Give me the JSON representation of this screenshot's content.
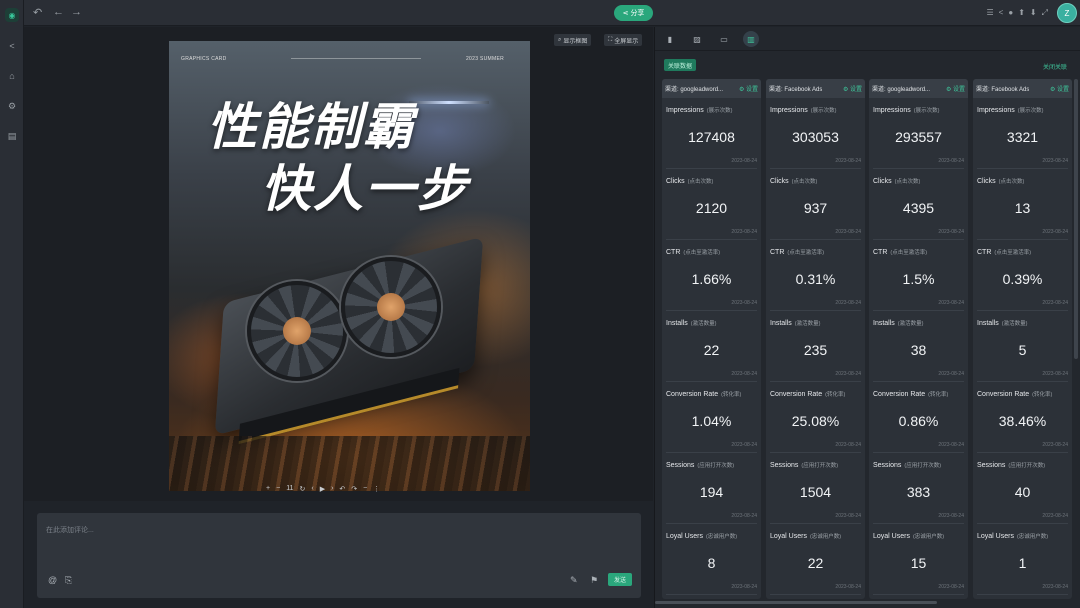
{
  "toolbar": {
    "share_label": "分享",
    "avatar_initial": "Z"
  },
  "canvas": {
    "show_frame_label": "显示框图",
    "fullscreen_label": "全屏显示",
    "zoom_value": "11"
  },
  "poster": {
    "top_left_text": "GRAPHICS CARD",
    "top_right_text": "2023 SUMMER",
    "headline_line1": "性能制霸",
    "headline_line2": "快人一步"
  },
  "comment": {
    "placeholder": "在此添加评论...",
    "send_label": "发送"
  },
  "panel": {
    "linked_label": "关联数据",
    "unlink_label": "关闭关联",
    "set_label": "⚙ 设置",
    "columns": [
      {
        "title": "渠道: googleadword...",
        "metrics": [
          {
            "label": "Impressions",
            "cn": "(展示次数)",
            "value": "127408",
            "date": "2023-08-24"
          },
          {
            "label": "Clicks",
            "cn": "(点击次数)",
            "value": "2120",
            "date": "2023-08-24"
          },
          {
            "label": "CTR",
            "cn": "(点击至激活率)",
            "value": "1.66%",
            "date": "2023-08-24"
          },
          {
            "label": "Installs",
            "cn": "(激活数量)",
            "value": "22",
            "date": "2023-08-24"
          },
          {
            "label": "Conversion Rate",
            "cn": "(转化率)",
            "value": "1.04%",
            "date": "2023-08-24"
          },
          {
            "label": "Sessions",
            "cn": "(应用打开次数)",
            "value": "194",
            "date": "2023-08-24"
          },
          {
            "label": "Loyal Users",
            "cn": "(忠诚用户数)",
            "value": "8",
            "date": "2023-08-24"
          }
        ]
      },
      {
        "title": "渠道: Facebook Ads",
        "metrics": [
          {
            "label": "Impressions",
            "cn": "(展示次数)",
            "value": "303053",
            "date": "2023-08-24"
          },
          {
            "label": "Clicks",
            "cn": "(点击次数)",
            "value": "937",
            "date": "2023-08-24"
          },
          {
            "label": "CTR",
            "cn": "(点击至激活率)",
            "value": "0.31%",
            "date": "2023-08-24"
          },
          {
            "label": "Installs",
            "cn": "(激活数量)",
            "value": "235",
            "date": "2023-08-24"
          },
          {
            "label": "Conversion Rate",
            "cn": "(转化率)",
            "value": "25.08%",
            "date": "2023-08-24"
          },
          {
            "label": "Sessions",
            "cn": "(应用打开次数)",
            "value": "1504",
            "date": "2023-08-24"
          },
          {
            "label": "Loyal Users",
            "cn": "(忠诚用户数)",
            "value": "22",
            "date": "2023-08-24"
          }
        ]
      },
      {
        "title": "渠道: googleadword...",
        "metrics": [
          {
            "label": "Impressions",
            "cn": "(展示次数)",
            "value": "293557",
            "date": "2023-08-24"
          },
          {
            "label": "Clicks",
            "cn": "(点击次数)",
            "value": "4395",
            "date": "2023-08-24"
          },
          {
            "label": "CTR",
            "cn": "(点击至激活率)",
            "value": "1.5%",
            "date": "2023-08-24"
          },
          {
            "label": "Installs",
            "cn": "(激活数量)",
            "value": "38",
            "date": "2023-08-24"
          },
          {
            "label": "Conversion Rate",
            "cn": "(转化率)",
            "value": "0.86%",
            "date": "2023-08-24"
          },
          {
            "label": "Sessions",
            "cn": "(应用打开次数)",
            "value": "383",
            "date": "2023-08-24"
          },
          {
            "label": "Loyal Users",
            "cn": "(忠诚用户数)",
            "value": "15",
            "date": "2023-08-24"
          }
        ]
      },
      {
        "title": "渠道: Facebook Ads",
        "metrics": [
          {
            "label": "Impressions",
            "cn": "(展示次数)",
            "value": "3321",
            "date": "2023-08-24"
          },
          {
            "label": "Clicks",
            "cn": "(点击次数)",
            "value": "13",
            "date": "2023-08-24"
          },
          {
            "label": "CTR",
            "cn": "(点击至激活率)",
            "value": "0.39%",
            "date": "2023-08-24"
          },
          {
            "label": "Installs",
            "cn": "(激活数量)",
            "value": "5",
            "date": "2023-08-24"
          },
          {
            "label": "Conversion Rate",
            "cn": "(转化率)",
            "value": "38.46%",
            "date": "2023-08-24"
          },
          {
            "label": "Sessions",
            "cn": "(应用打开次数)",
            "value": "40",
            "date": "2023-08-24"
          },
          {
            "label": "Loyal Users",
            "cn": "(忠诚用户数)",
            "value": "1",
            "date": "2023-08-24"
          }
        ]
      }
    ]
  }
}
